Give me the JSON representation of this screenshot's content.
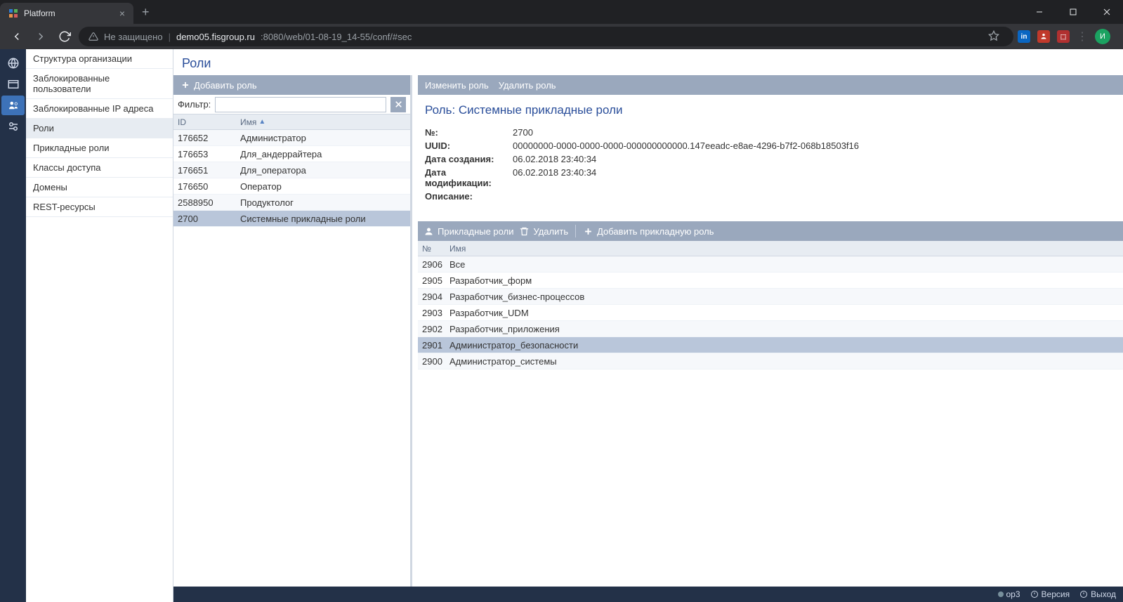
{
  "browser": {
    "tab_title": "Platform",
    "insecure_label": "Не защищено",
    "url_host": "demo05.fisgroup.ru",
    "url_port_path": ":8080/web/01-08-19_14-55/conf/#sec",
    "profile_letter": "И"
  },
  "sidebar": {
    "items": [
      {
        "label": "Структура организации"
      },
      {
        "label": "Заблокированные пользователи"
      },
      {
        "label": "Заблокированные IP адреса"
      },
      {
        "label": "Роли"
      },
      {
        "label": "Прикладные роли"
      },
      {
        "label": "Классы доступа"
      },
      {
        "label": "Домены"
      },
      {
        "label": "REST-ресурсы"
      }
    ],
    "selected_index": 3
  },
  "page": {
    "title": "Роли"
  },
  "roles_toolbar": {
    "add": "Добавить роль"
  },
  "filter": {
    "label": "Фильтр:",
    "value": ""
  },
  "roles_grid": {
    "headers": {
      "id": "ID",
      "name": "Имя"
    },
    "rows": [
      {
        "id": "176652",
        "name": "Администратор"
      },
      {
        "id": "176653",
        "name": "Для_андеррайтера"
      },
      {
        "id": "176651",
        "name": "Для_оператора"
      },
      {
        "id": "176650",
        "name": "Оператор"
      },
      {
        "id": "2588950",
        "name": "Продуктолог"
      },
      {
        "id": "2700",
        "name": "Системные прикладные роли"
      }
    ],
    "selected_index": 5
  },
  "right_toolbar": {
    "edit": "Изменить роль",
    "delete": "Удалить роль"
  },
  "detail": {
    "title": "Роль: Системные прикладные роли",
    "fields": {
      "no_label": "№:",
      "no_value": "2700",
      "uuid_label": "UUID:",
      "uuid_value": "00000000-0000-0000-0000-000000000000.147eeadc-e8ae-4296-b7f2-068b18503f16",
      "created_label": "Дата создания:",
      "created_value": "06.02.2018 23:40:34",
      "modified_label": "Дата модификации:",
      "modified_value": "06.02.2018 23:40:34",
      "description_label": "Описание:",
      "description_value": ""
    }
  },
  "sub_toolbar": {
    "tab": "Прикладные роли",
    "delete": "Удалить",
    "add": "Добавить прикладную роль"
  },
  "sub_grid": {
    "headers": {
      "no": "№",
      "name": "Имя"
    },
    "rows": [
      {
        "no": "2906",
        "name": "Все"
      },
      {
        "no": "2905",
        "name": "Разработчик_форм"
      },
      {
        "no": "2904",
        "name": "Разработчик_бизнес-процессов"
      },
      {
        "no": "2903",
        "name": "Разработчик_UDM"
      },
      {
        "no": "2902",
        "name": "Разработчик_приложения"
      },
      {
        "no": "2901",
        "name": "Администратор_безопасности"
      },
      {
        "no": "2900",
        "name": "Администратор_системы"
      }
    ],
    "selected_index": 5
  },
  "footer": {
    "node": "op3",
    "version": "Версия",
    "logout": "Выход"
  }
}
